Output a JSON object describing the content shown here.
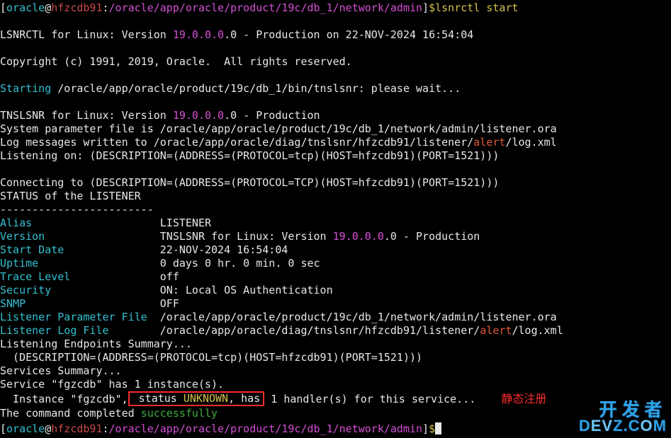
{
  "prompt1": {
    "bracket_open": "[",
    "user": "oracle",
    "at": "@",
    "host": "hfzcdb91",
    "colon": ":",
    "path": "/oracle/app/oracle/product/19c/db_1/network/admin",
    "bracket_close": "]",
    "dollar": "$",
    "command": "lsnrctl start"
  },
  "header1": {
    "pre": "LSNRCTL for Linux: Version ",
    "ver": "19.0.0.0",
    "post": ".0 - Production on 22-NOV-2024 16:54:04"
  },
  "copyright": "Copyright (c) 1991, 2019, Oracle.  All rights reserved.",
  "starting": {
    "label": "Starting",
    "rest": " /oracle/app/oracle/product/19c/db_1/bin/tnslsnr: please wait..."
  },
  "tnslsnr": {
    "pre": "TNSLSNR for Linux: Version ",
    "ver": "19.0.0.0",
    "post": ".0 - Production"
  },
  "sys_param": "System parameter file is /oracle/app/oracle/product/19c/db_1/network/admin/listener.ora",
  "logmsg": {
    "pre": "Log messages written to /oracle/app/oracle/diag/tnslsnr/hfzcdb91/listener/",
    "alert": "alert",
    "post": "/log.xml"
  },
  "listen_on": "Listening on: (DESCRIPTION=(ADDRESS=(PROTOCOL=tcp)(HOST=hfzcdb91)(PORT=1521)))",
  "connecting": "Connecting to (DESCRIPTION=(ADDRESS=(PROTOCOL=TCP)(HOST=hfzcdb91)(PORT=1521)))",
  "status_hdr": "STATUS of the LISTENER",
  "dashes": "------------------------",
  "rows": {
    "alias": {
      "label": "Alias",
      "value": "LISTENER"
    },
    "version": {
      "label": "Version",
      "pre": "TNSLSNR for Linux: Version ",
      "ver": "19.0.0.0",
      "post": ".0 - Production"
    },
    "start": {
      "label": "Start Date",
      "value": "22-NOV-2024 16:54:04"
    },
    "uptime": {
      "label": "Uptime",
      "value": "0 days 0 hr. 0 min. 0 sec"
    },
    "trace": {
      "label": "Trace Level",
      "value": "off"
    },
    "security": {
      "label": "Security",
      "value": "ON: Local OS Authentication"
    },
    "snmp": {
      "label": "SNMP",
      "value": "OFF"
    },
    "param": {
      "label": "Listener Parameter File",
      "value": "/oracle/app/oracle/product/19c/db_1/network/admin/listener.ora"
    },
    "log": {
      "label": "Listener Log File",
      "pre": "/oracle/app/oracle/diag/tnslsnr/hfzcdb91/listener/",
      "alert": "alert",
      "post": "/log.xml"
    }
  },
  "endpoints_hdr": "Listening Endpoints Summary...",
  "endpoint1": "  (DESCRIPTION=(ADDRESS=(PROTOCOL=tcp)(HOST=hfzcdb91)(PORT=1521)))",
  "services_hdr": "Services Summary...",
  "service_line": "Service \"fgzcdb\" has 1 instance(s).",
  "instance_line": {
    "pre": "  Instance \"fgzcdb\",",
    "box_pre": " status ",
    "box_kw": "UNKNOWN",
    "box_post": ", has",
    "rest": " 1 handler(s) for this service..."
  },
  "annotation": "静态注册",
  "completed": {
    "pre": "The command completed ",
    "word": "successfully"
  },
  "prompt2": {
    "bracket_open": "[",
    "user": "oracle",
    "at": "@",
    "host": "hfzcdb91",
    "colon": ":",
    "path": "/oracle/app/oracle/product/19c/db_1/network/admin",
    "bracket_close": "]",
    "dollar": "$"
  },
  "watermark": {
    "line1": "开发者",
    "line2a": "D",
    "line2b": "EV",
    "line2c": "Z.C",
    "line2d": "O",
    "line2e": "M"
  }
}
